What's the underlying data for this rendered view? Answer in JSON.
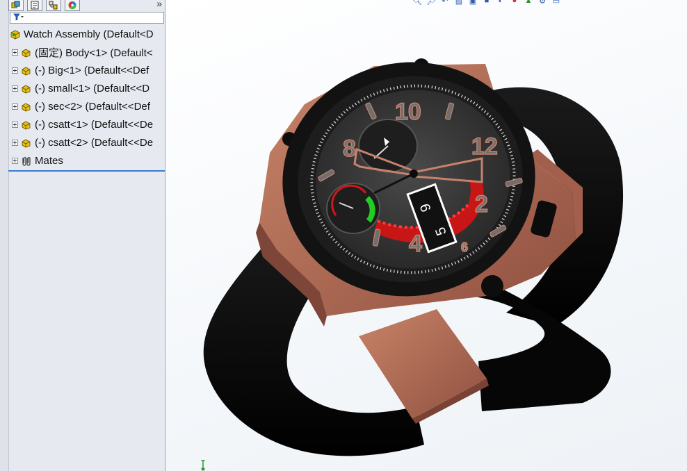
{
  "feature_manager": {
    "tabs": [
      {
        "name": "feature-manager-tab",
        "icon": "assembly-tree-icon"
      },
      {
        "name": "property-manager-tab",
        "icon": "property-sheet-icon"
      },
      {
        "name": "configuration-manager-tab",
        "icon": "configuration-icon"
      },
      {
        "name": "display-manager-tab",
        "icon": "appearance-pie-icon"
      }
    ],
    "expand_glyph": "»",
    "filter_icon": "funnel-icon",
    "tree": {
      "root": {
        "label": "Watch Assembly  (Default<D"
      },
      "items": [
        {
          "label": "(固定) Body<1> (Default<"
        },
        {
          "label": "(-) Big<1> (Default<<Def"
        },
        {
          "label": "(-) small<1> (Default<<D"
        },
        {
          "label": "(-) sec<2> (Default<<Def"
        },
        {
          "label": "(-) csatt<1> (Default<<De"
        },
        {
          "label": "(-) csatt<2> (Default<<De"
        }
      ],
      "mates": {
        "label": "Mates"
      }
    }
  },
  "view_toolbar": {
    "icons": [
      "zoom-to-fit-icon",
      "zoom-area-icon",
      "previous-view-icon",
      "section-view-icon",
      "view-orientation-icon",
      "display-style-icon",
      "hide-show-icon",
      "edit-appearance-icon",
      "apply-scene-icon",
      "view-settings-icon",
      "monitor-icon"
    ]
  },
  "model": {
    "name": "watch-model",
    "dial_numbers": [
      "10",
      "12",
      "2",
      "4",
      "6",
      "8"
    ],
    "date_window": [
      "9",
      "5"
    ],
    "colors": {
      "case": "#b8725c",
      "case_shadow": "#7d4638",
      "strap": "#050505",
      "bezel": "#121212",
      "dial": "#3a3a3a",
      "accent_red": "#d01818",
      "accent_green": "#22cc22",
      "hands": "#c8826c"
    }
  }
}
